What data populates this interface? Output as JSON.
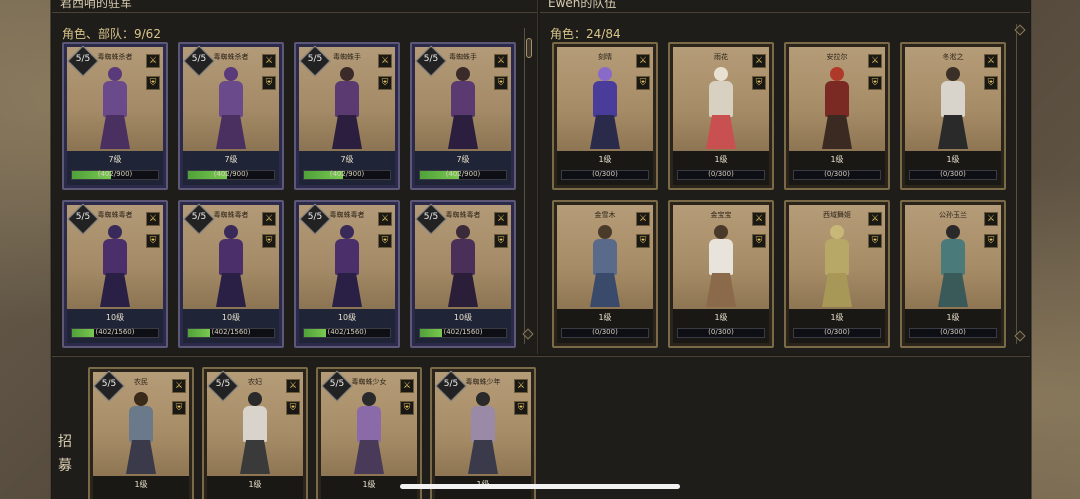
{
  "left_panel": {
    "title": "君西哨的驻军",
    "count_label": "角色、部队：9/62",
    "cards": [
      {
        "level_badge": "5/5",
        "name": "毒蜘蛛杀者",
        "level": "7级",
        "xp": "(402/900)",
        "progress": 0.45,
        "theme": "purple",
        "figure": "purple-hood-a"
      },
      {
        "level_badge": "5/5",
        "name": "毒蜘蛛杀者",
        "level": "7级",
        "xp": "(402/900)",
        "progress": 0.45,
        "theme": "purple",
        "figure": "purple-hood-a"
      },
      {
        "level_badge": "5/5",
        "name": "毒蜘蛛手",
        "level": "7级",
        "xp": "(402/900)",
        "progress": 0.45,
        "theme": "purple",
        "figure": "purple-dress"
      },
      {
        "level_badge": "5/5",
        "name": "毒蜘蛛手",
        "level": "7级",
        "xp": "(402/900)",
        "progress": 0.45,
        "theme": "purple",
        "figure": "purple-dress"
      },
      {
        "level_badge": "5/5",
        "name": "毒蜘蛛毒者",
        "level": "10级",
        "xp": "(402/1560)",
        "progress": 0.26,
        "theme": "purple",
        "figure": "purple-hood-b"
      },
      {
        "level_badge": "5/5",
        "name": "毒蜘蛛毒者",
        "level": "10级",
        "xp": "(402/1560)",
        "progress": 0.26,
        "theme": "purple",
        "figure": "purple-hood-b"
      },
      {
        "level_badge": "5/5",
        "name": "毒蜘蛛毒者",
        "level": "10级",
        "xp": "(402/1560)",
        "progress": 0.26,
        "theme": "purple",
        "figure": "purple-hood-b"
      },
      {
        "level_badge": "5/5",
        "name": "毒蜘蛛毒者",
        "level": "10级",
        "xp": "(402/1560)",
        "progress": 0.26,
        "theme": "purple",
        "figure": "purple-spear"
      }
    ]
  },
  "right_panel": {
    "title": "Ewen的队伍",
    "count_label": "角色：24/84",
    "cards": [
      {
        "level_badge": "",
        "name": "刻晴",
        "level": "1级",
        "xp": "(0/300)",
        "progress": 0,
        "theme": "gold",
        "figure": "purple-anime"
      },
      {
        "level_badge": "",
        "name": "雨花",
        "level": "1级",
        "xp": "(0/300)",
        "progress": 0,
        "theme": "gold",
        "figure": "white-robe"
      },
      {
        "level_badge": "",
        "name": "安拉尔",
        "level": "1级",
        "xp": "(0/300)",
        "progress": 0,
        "theme": "gold",
        "figure": "red-hair"
      },
      {
        "level_badge": "",
        "name": "冬淞之",
        "level": "1级",
        "xp": "(0/300)",
        "progress": 0,
        "theme": "gold",
        "figure": "white-cape"
      },
      {
        "level_badge": "",
        "name": "金雪木",
        "level": "1级",
        "xp": "(0/300)",
        "progress": 0,
        "theme": "gold",
        "figure": "blue-dancer"
      },
      {
        "level_badge": "",
        "name": "金宝宝",
        "level": "1级",
        "xp": "(0/300)",
        "progress": 0,
        "theme": "gold",
        "figure": "white-dancer"
      },
      {
        "level_badge": "",
        "name": "西域舞姬",
        "level": "1级",
        "xp": "(0/300)",
        "progress": 0,
        "theme": "gold",
        "figure": "veil-dancer"
      },
      {
        "level_badge": "",
        "name": "公孙玉兰",
        "level": "1级",
        "xp": "(0/300)",
        "progress": 0,
        "theme": "gold",
        "figure": "teal-lady"
      }
    ]
  },
  "recruit": {
    "label_1": "招",
    "label_2": "募",
    "cards": [
      {
        "level_badge": "5/5",
        "name": "农民",
        "level": "1级",
        "theme": "gold",
        "figure": "peasant-fork"
      },
      {
        "level_badge": "5/5",
        "name": "农妇",
        "level": "1级",
        "theme": "gold",
        "figure": "peasant-woman"
      },
      {
        "level_badge": "5/5",
        "name": "毒蜘蛛少女",
        "level": "1级",
        "theme": "gold",
        "figure": "spear-girl"
      },
      {
        "level_badge": "5/5",
        "name": "毒蜘蛛少年",
        "level": "1级",
        "theme": "gold",
        "figure": "spear-boy"
      }
    ]
  },
  "colors": {
    "accent_gold": "#d9c58a",
    "xp_green": "#6bbf45",
    "card_purple": "#5e5878",
    "card_gold": "#7a6a48"
  },
  "icons": {
    "weapon": "sword-icon",
    "armor": "armor-icon"
  }
}
